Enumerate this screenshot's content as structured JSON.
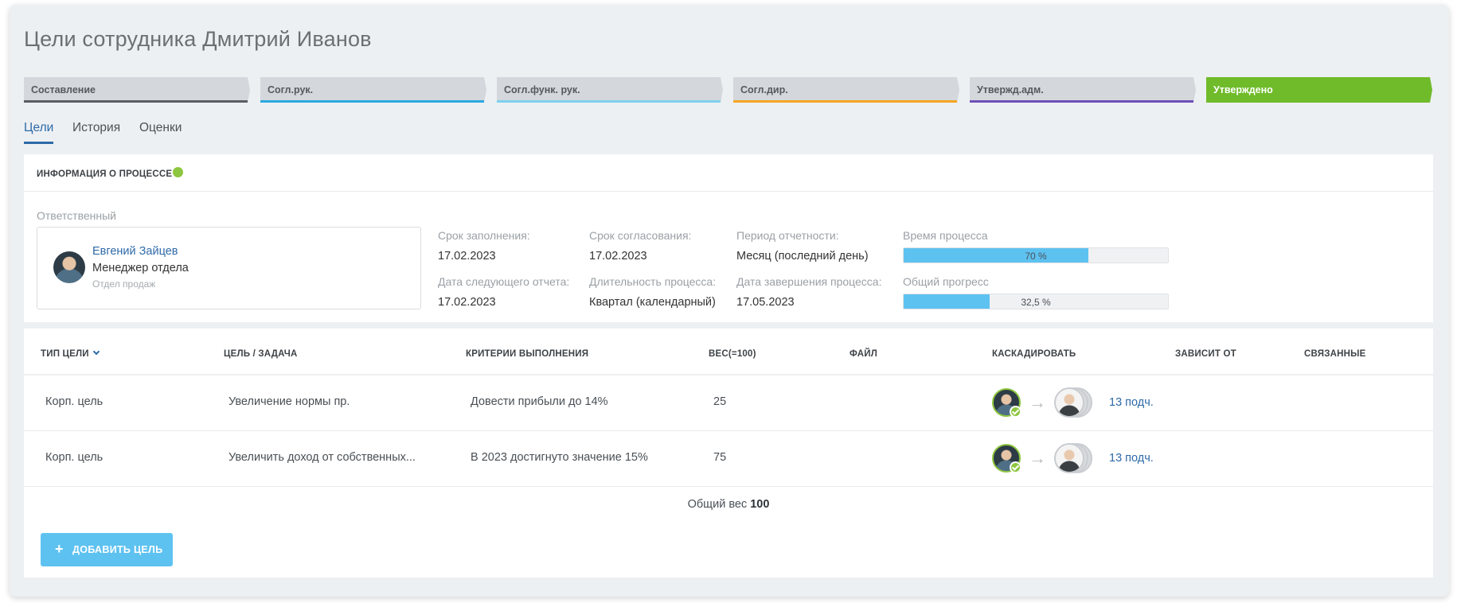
{
  "page": {
    "title": "Цели сотрудника Дмитрий Иванов"
  },
  "stages": [
    {
      "label": "Составление",
      "color": "#5a5f64"
    },
    {
      "label": "Согл.рук.",
      "color": "#2aa9e0"
    },
    {
      "label": "Согл.функ. рук.",
      "color": "#7fd0ef"
    },
    {
      "label": "Согл.дир.",
      "color": "#f5a623"
    },
    {
      "label": "Утвержд.адм.",
      "color": "#6f4fb8"
    },
    {
      "label": "Утверждено",
      "color": "#6fbb2a"
    }
  ],
  "tabs": [
    {
      "label": "Цели",
      "active": true
    },
    {
      "label": "История",
      "active": false
    },
    {
      "label": "Оценки",
      "active": false
    }
  ],
  "info": {
    "heading": "ИНФОРМАЦИЯ О ПРОЦЕССЕ",
    "status_color": "#8dc63f",
    "responsible": {
      "label": "Ответственный",
      "name": "Евгений Зайцев",
      "position": "Менеджер отдела",
      "department": "Отдел продаж"
    },
    "fields": {
      "fill_deadline": {
        "label": "Срок заполнения:",
        "value": "17.02.2023"
      },
      "approval_deadline": {
        "label": "Срок согласования:",
        "value": "17.02.2023"
      },
      "reporting_period": {
        "label": "Период отчетности:",
        "value": "Месяц (последний день)"
      },
      "next_report_date": {
        "label": "Дата следующего отчета:",
        "value": "17.02.2023"
      },
      "process_duration": {
        "label": "Длительность процесса:",
        "value": "Квартал (календарный)"
      },
      "process_end_date": {
        "label": "Дата завершения процесса:",
        "value": "17.05.2023"
      }
    },
    "process_time": {
      "label": "Время процесса",
      "percent": 70,
      "text": "70 %"
    },
    "overall_progress": {
      "label": "Общий прогресс",
      "percent": 32.5,
      "text": "32,5 %"
    }
  },
  "goals": {
    "columns": {
      "type": "ТИП ЦЕЛИ",
      "goal": "ЦЕЛЬ / ЗАДАЧА",
      "criteria": "КРИТЕРИИ ВЫПОЛНЕНИЯ",
      "weight": "ВЕС(=100)",
      "file": "ФАЙЛ",
      "cascade": "КАСКАДИРОВАТЬ",
      "depends": "ЗАВИСИТ ОТ",
      "related": "СВЯЗАННЫЕ"
    },
    "rows": [
      {
        "type": "Корп. цель",
        "goal": "Увеличение нормы пр.",
        "criteria": "Довести прибыли до 14%",
        "weight": "25",
        "cascade_link": "13 подч."
      },
      {
        "type": "Корп. цель",
        "goal": "Увеличить доход от собственных...",
        "criteria": "В 2023 достигнуто значение 15%",
        "weight": "75",
        "cascade_link": "13 подч."
      }
    ],
    "total_label": "Общий вес",
    "total_value": "100",
    "add_button": "ДОБАВИТЬ ЦЕЛЬ"
  },
  "icons": {
    "arrow": "arrow-right-icon",
    "check": "check-icon",
    "plus": "plus-icon",
    "sort": "chevron-down-icon"
  }
}
